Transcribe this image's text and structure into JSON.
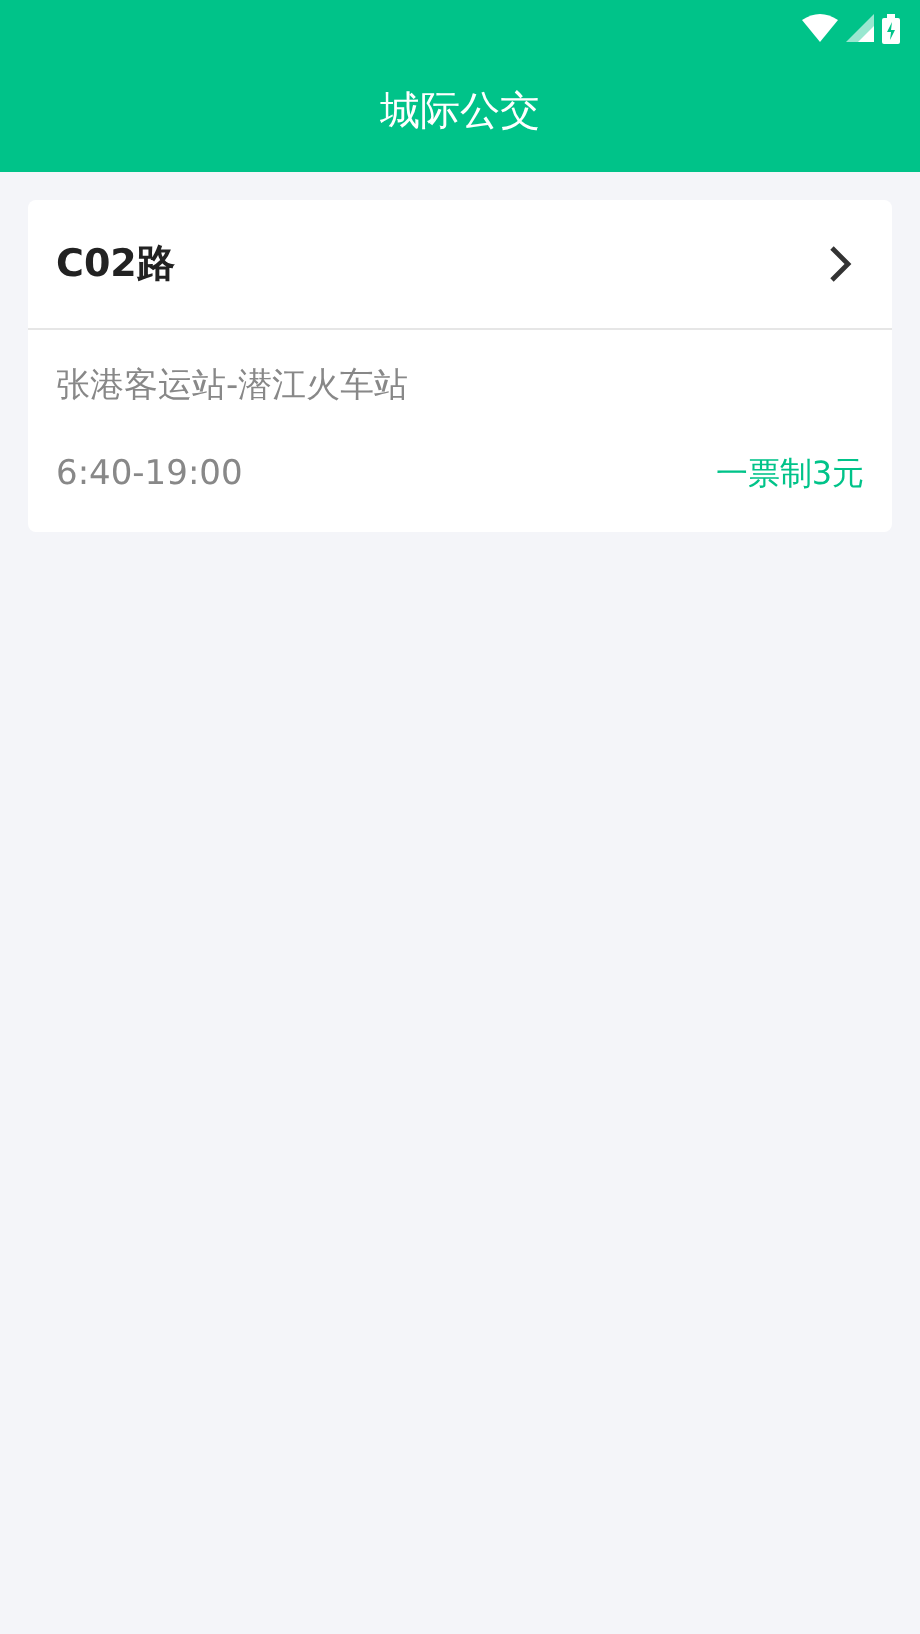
{
  "header": {
    "title": "城际公交"
  },
  "routes": [
    {
      "name": "C02路",
      "stops": "张港客运站-潜江火车站",
      "hours": "6:40-19:00",
      "fare": "一票制3元"
    }
  ]
}
